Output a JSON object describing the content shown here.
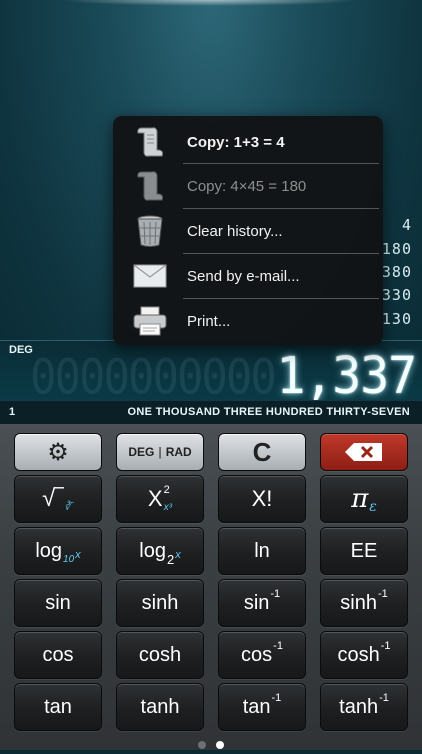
{
  "display": {
    "history": [
      "4",
      "180",
      "380",
      "330",
      "130",
      "..."
    ],
    "angle_mode": "DEG",
    "ghost_digits": "0000000000",
    "value": "1,337",
    "memory": "1",
    "value_words": "ONE THOUSAND THREE HUNDRED THIRTY-SEVEN"
  },
  "popup": {
    "items": [
      {
        "label": "Copy: 1+3 = 4",
        "icon": "scroll-icon",
        "bold": true
      },
      {
        "label": "Copy: 4×45 = 180",
        "icon": "scroll-icon",
        "dim": true
      },
      {
        "label": "Clear history...",
        "icon": "trash-icon"
      },
      {
        "label": "Send by e-mail...",
        "icon": "envelope-icon"
      },
      {
        "label": "Print...",
        "icon": "printer-icon"
      }
    ]
  },
  "keys": {
    "settings": "⚙",
    "deg": "DEG",
    "rad": "RAD",
    "clear": "C",
    "backspace": "✕",
    "sqrt": "√‾",
    "sqrt_alt": "∛‾",
    "x": "X",
    "x_sup": "2",
    "x_alt": "x³",
    "fact": "X!",
    "pi": "π",
    "pi_alt": "ε",
    "log": "log",
    "log_sub": "10",
    "log_alt": "x",
    "log2": "log",
    "log2_sub": "2",
    "log2_alt": "x",
    "ln": "ln",
    "ee": "EE",
    "sin": "sin",
    "sinh": "sinh",
    "asin": "sin",
    "asinh": "sinh",
    "cos": "cos",
    "cosh": "cosh",
    "acos": "cos",
    "acosh": "cosh",
    "tan": "tan",
    "tanh": "tanh",
    "atan": "tan",
    "atanh": "tanh",
    "inverse_sup": "-1"
  },
  "colors": {
    "accent_blue": "#62c7f2",
    "danger_red": "#b3291d",
    "lcd_glow": "#aaf0ff"
  }
}
